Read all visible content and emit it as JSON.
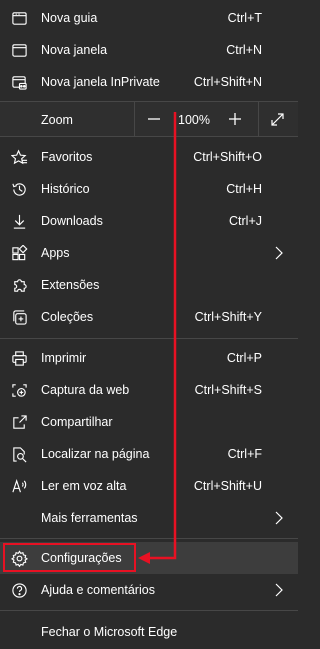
{
  "menu": {
    "items_top": [
      {
        "label": "Nova guia",
        "shortcut": "Ctrl+T",
        "icon": "new-tab-icon"
      },
      {
        "label": "Nova janela",
        "shortcut": "Ctrl+N",
        "icon": "new-window-icon"
      },
      {
        "label": "Nova janela InPrivate",
        "shortcut": "Ctrl+Shift+N",
        "icon": "inprivate-icon"
      }
    ],
    "zoom": {
      "label": "Zoom",
      "value": "100%",
      "minus": "—",
      "plus": "+"
    },
    "items_mid": [
      {
        "label": "Favoritos",
        "shortcut": "Ctrl+Shift+O",
        "icon": "favorites-icon"
      },
      {
        "label": "Histórico",
        "shortcut": "Ctrl+H",
        "icon": "history-icon"
      },
      {
        "label": "Downloads",
        "shortcut": "Ctrl+J",
        "icon": "download-icon"
      },
      {
        "label": "Apps",
        "shortcut": "",
        "icon": "apps-icon"
      },
      {
        "label": "Extensões",
        "shortcut": "",
        "icon": "extensions-icon"
      },
      {
        "label": "Coleções",
        "shortcut": "Ctrl+Shift+Y",
        "icon": "collections-icon"
      }
    ],
    "items_tools": [
      {
        "label": "Imprimir",
        "shortcut": "Ctrl+P",
        "icon": "print-icon"
      },
      {
        "label": "Captura da web",
        "shortcut": "Ctrl+Shift+S",
        "icon": "web-capture-icon"
      },
      {
        "label": "Compartilhar",
        "shortcut": "",
        "icon": "share-icon"
      },
      {
        "label": "Localizar na página",
        "shortcut": "Ctrl+F",
        "icon": "find-icon"
      },
      {
        "label": "Ler em voz alta",
        "shortcut": "Ctrl+Shift+U",
        "icon": "read-aloud-icon"
      },
      {
        "label": "Mais ferramentas",
        "shortcut": ""
      }
    ],
    "items_bottom": [
      {
        "label": "Configurações",
        "icon": "settings-icon"
      },
      {
        "label": "Ajuda e comentários",
        "icon": "help-icon"
      }
    ],
    "close": {
      "label": "Fechar o Microsoft Edge"
    }
  },
  "colors": {
    "background": "#2b2b2b",
    "highlight": "#3d3d3d",
    "annotation": "#e81123"
  }
}
